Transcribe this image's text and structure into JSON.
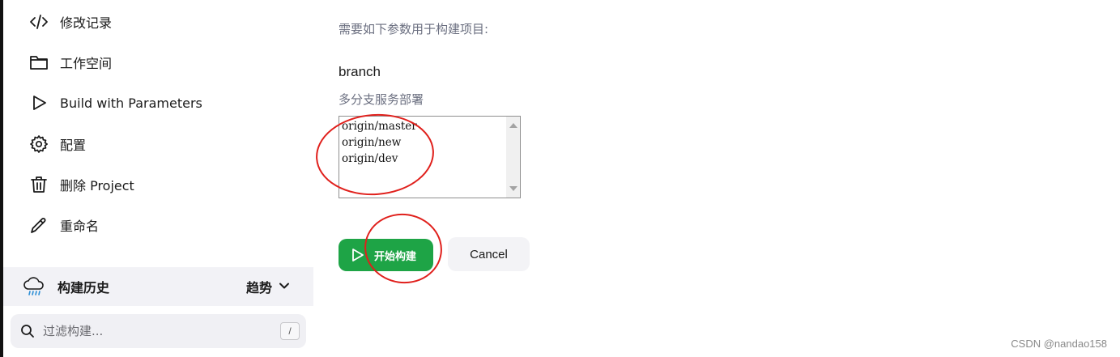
{
  "sidebar": {
    "items": [
      {
        "label": "修改记录",
        "icon": "code-icon"
      },
      {
        "label": "工作空间",
        "icon": "folder-icon"
      },
      {
        "label": "Build with Parameters",
        "icon": "play-icon"
      },
      {
        "label": "配置",
        "icon": "gear-icon"
      },
      {
        "label": "删除 Project",
        "icon": "trash-icon"
      },
      {
        "label": "重命名",
        "icon": "pencil-icon"
      }
    ],
    "build_history": {
      "title": "构建历史",
      "trend_label": "趋势",
      "icon": "cloud-rain-icon"
    },
    "filter": {
      "placeholder": "过滤构建...",
      "shortcut": "/"
    }
  },
  "main": {
    "description": "需要如下参数用于构建项目:",
    "parameter": {
      "name": "branch",
      "description": "多分支服务部署",
      "options": [
        "origin/master",
        "origin/new",
        "origin/dev"
      ]
    },
    "buttons": {
      "build_label": "开始构建",
      "cancel_label": "Cancel"
    }
  },
  "colors": {
    "build_button": "#1ea446",
    "annotation": "#e0201c",
    "muted_text": "#6b6f80"
  },
  "watermark": "CSDN @nandao158"
}
